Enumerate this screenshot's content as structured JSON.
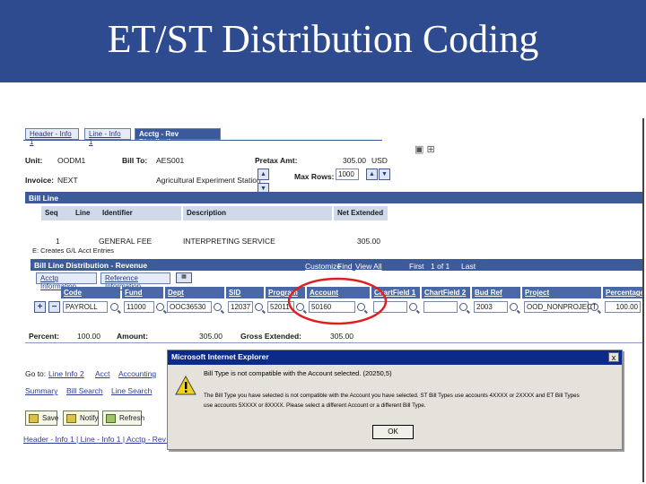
{
  "banner": {
    "title": "ET/ST Distribution Coding"
  },
  "tabs": [
    {
      "label": "Header - Info 1"
    },
    {
      "label": "Line - Info 1"
    },
    {
      "label": "Acctg - Rev Distribution"
    }
  ],
  "header": {
    "unit_label": "Unit:",
    "unit_value": "OODM1",
    "billto_label": "Bill To:",
    "billto_value": "AES001",
    "pretax_label": "Pretax Amt:",
    "pretax_value": "305.00",
    "pretax_currency": "USD",
    "invoice_label": "Invoice:",
    "invoice_value": "NEXT",
    "customer_name": "Agricultural Experiment Station",
    "maxrows_label": "Max Rows:",
    "maxrows_value": "1000"
  },
  "bill_line": {
    "title": "Bill Line",
    "columns": [
      "Seq",
      "Line",
      "Identifier",
      "Description",
      "Net Extended"
    ],
    "row": {
      "seq": "1",
      "line": "",
      "identifier": "GENERAL FEE",
      "description": "INTERPRETING SERVICE",
      "net_extended": "305.00"
    },
    "note": "E: Creates G/L Acct Entries"
  },
  "distribution": {
    "title": "Bill Line Distribution - Revenue",
    "nav": {
      "customize": "Customize",
      "find": "Find",
      "view_all": "View All",
      "first": "First",
      "count": "1 of 1",
      "last": "Last"
    },
    "subtabs": [
      "Acctg Information",
      "Reference Information"
    ],
    "columns": [
      "Code",
      "Fund",
      "Dept",
      "SID",
      "Program",
      "Account",
      "ChartField 1",
      "ChartField 2",
      "Bud Ref",
      "Project",
      "Percentage"
    ],
    "row": {
      "code": "PAYROLL",
      "fund": "11000",
      "dept": "OOC36530",
      "sid": "12037",
      "program": "52011",
      "account": "50160",
      "chartfield1": "",
      "chartfield2": "",
      "budref": "2003",
      "project": "OOD_NONPROJECT",
      "percentage": "100.00"
    },
    "percent_label": "Percent:",
    "percent_value": "100.00",
    "amount_label": "Amount:",
    "amount_value": "305.00",
    "gross_label": "Gross Extended:",
    "gross_value": "305.00"
  },
  "goto": {
    "label": "Go to:",
    "items": [
      "Line Info 2",
      "Acct",
      "Accounting"
    ]
  },
  "links": [
    "Summary",
    "Bill Search",
    "Line Search"
  ],
  "buttons": {
    "save": "Save",
    "notify": "Notify",
    "refresh": "Refresh"
  },
  "footer_links": "Header - Info 1 | Line - Info 1 | Acctg - Rev Dist",
  "dialog": {
    "title": "Microsoft Internet Explorer",
    "line1": "Bill Type is not compatible with the Account selected. (20250,5)",
    "line2": "The Bill Type you have selected is not compatible with the Account you have selected.  ST Bill Types use accounts 4XXXX or 2XXXX and ET Bill Types",
    "line3": "use accounts 5XXXX or 8XXXX. Please select a different Account or a different Bill Type.",
    "ok": "OK",
    "close": "x"
  },
  "colors": {
    "banner": "#2e4b8f",
    "bar": "#3d5b99",
    "highlight_circle": "#e02020",
    "dialog_title": "#0a2a8c"
  }
}
